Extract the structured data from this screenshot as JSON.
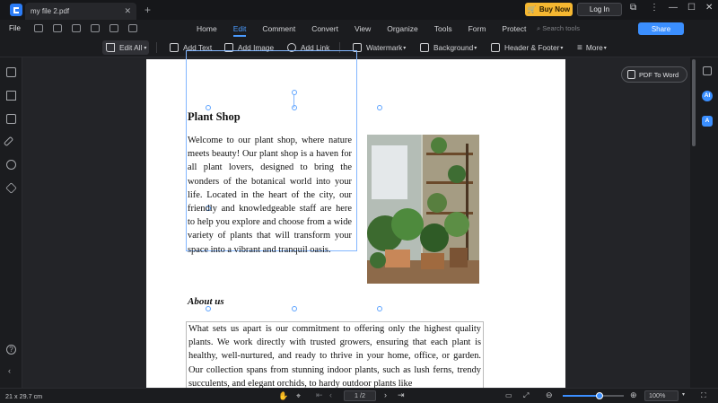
{
  "titlebar": {
    "tab_title": "my file 2.pdf",
    "buy_now": "Buy Now",
    "login": "Log In"
  },
  "menubar": {
    "file": "File",
    "search_placeholder": "Search tools",
    "items": [
      "Home",
      "Edit",
      "Comment",
      "Convert",
      "View",
      "Organize",
      "Tools",
      "Form",
      "Protect"
    ],
    "active": "Edit",
    "share": "Share"
  },
  "toolbar": {
    "edit_all": "Edit All",
    "add_text": "Add Text",
    "add_image": "Add Image",
    "add_link": "Add Link",
    "watermark": "Watermark",
    "background": "Background",
    "header_footer": "Header & Footer",
    "more": "More"
  },
  "side_panel": {
    "pdf_to_word": "PDF To Word"
  },
  "document": {
    "heading": "Plant Shop",
    "paragraph1": "Welcome to our plant shop, where nature meets beauty! Our plant shop is a haven for all plant lovers, designed to bring the wonders of the botanical world into your life. Located in the heart of the city, our friendly and knowledgeable staff are here to help you explore and choose from a wide variety of plants that will transform your space into a vibrant and tranquil oasis.",
    "subheading": "About us",
    "paragraph2": "What sets us apart is our commitment to offering only the highest quality plants. We work directly with trusted growers, ensuring that each plant is healthy, well-nurtured, and ready to thrive in your home, office, or garden. Our collection spans from stunning indoor plants, such as lush ferns, trendy succulents, and elegant orchids, to hardy outdoor plants like"
  },
  "statusbar": {
    "page_size": "21 x 29.7 cm",
    "page_indicator": "1 /2",
    "zoom": "100%"
  },
  "colors": {
    "accent": "#3b8fff",
    "buy_now": "#f5b731",
    "selection": "#82b6ff"
  }
}
